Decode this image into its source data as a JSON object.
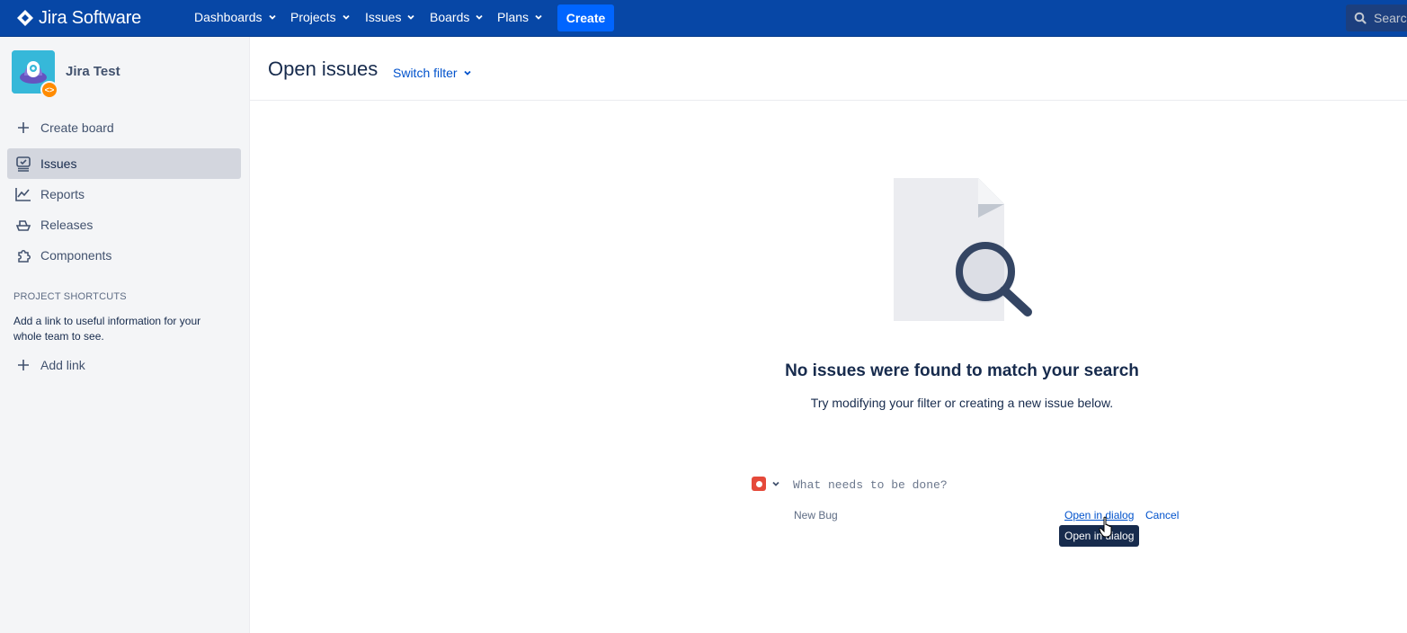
{
  "topbar": {
    "app_name": "Jira Software",
    "nav": [
      {
        "label": "Dashboards"
      },
      {
        "label": "Projects"
      },
      {
        "label": "Issues"
      },
      {
        "label": "Boards"
      },
      {
        "label": "Plans"
      }
    ],
    "create_label": "Create",
    "search_placeholder": "Search",
    "colors": {
      "background": "#0747a6",
      "create": "#0065ff"
    }
  },
  "sidebar": {
    "project_name": "Jira Test",
    "avatar_icon": "rocket-avatar-icon",
    "items": [
      {
        "label": "Create board",
        "icon": "plus-icon"
      },
      {
        "label": "Issues",
        "icon": "issues-icon",
        "active": true
      },
      {
        "label": "Reports",
        "icon": "reports-icon"
      },
      {
        "label": "Releases",
        "icon": "releases-icon"
      },
      {
        "label": "Components",
        "icon": "components-icon"
      }
    ],
    "shortcuts": {
      "title": "PROJECT SHORTCUTS",
      "description": "Add a link to useful information for your whole team to see.",
      "add_link_label": "Add link"
    }
  },
  "main": {
    "title": "Open issues",
    "switch_filter_label": "Switch filter",
    "empty_state": {
      "title": "No issues were found to match your search",
      "subtitle": "Try modifying your filter or creating a new issue below."
    },
    "inline_create": {
      "placeholder": "What needs to be done?",
      "issue_type_label": "New Bug",
      "issue_type_color": "#e5493a",
      "open_in_dialog_label": "Open in dialog",
      "cancel_label": "Cancel",
      "tooltip": "Open in dialog"
    }
  }
}
